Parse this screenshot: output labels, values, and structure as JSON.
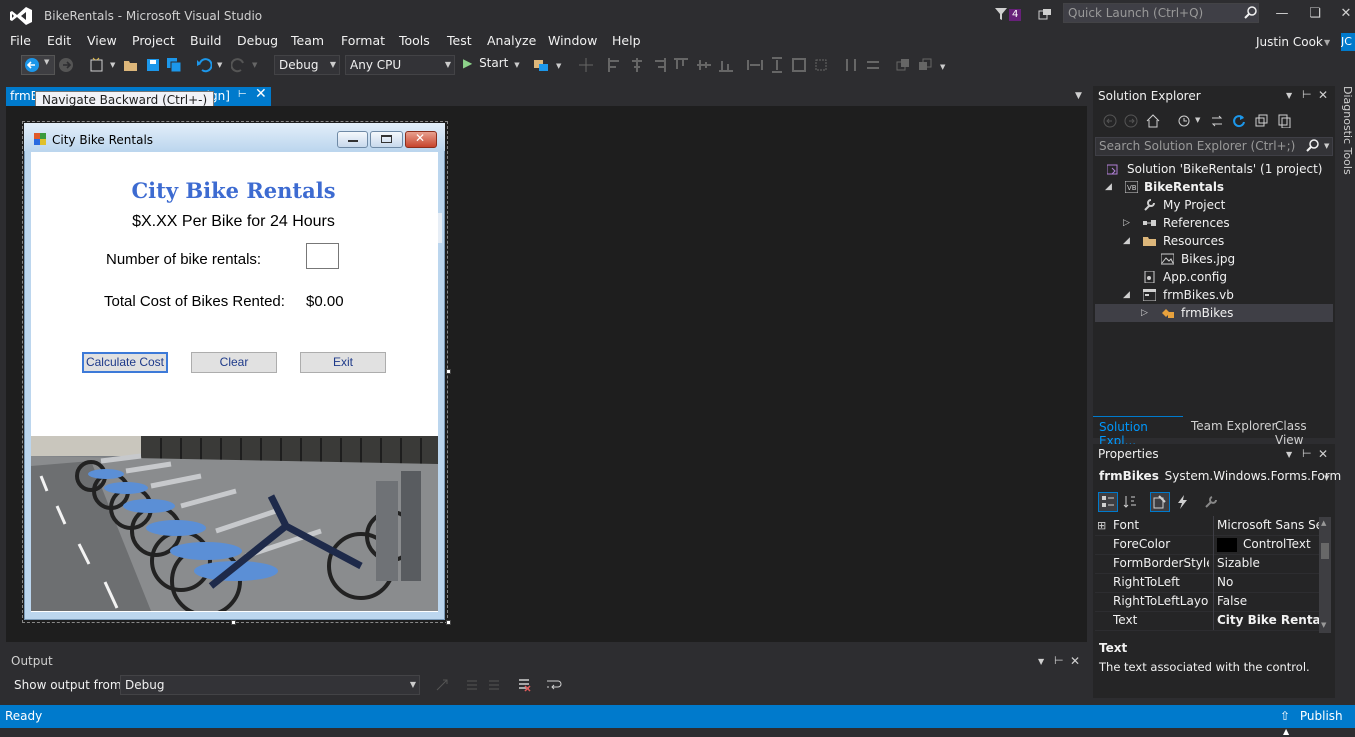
{
  "window": {
    "title": "BikeRentals - Microsoft Visual Studio",
    "notification_count": "4",
    "quick_launch_placeholder": "Quick Launch (Ctrl+Q)",
    "user_name": "Justin Cook",
    "user_initials": "JC"
  },
  "menu": [
    "File",
    "Edit",
    "View",
    "Project",
    "Build",
    "Debug",
    "Team",
    "Format",
    "Tools",
    "Test",
    "Analyze",
    "Window",
    "Help"
  ],
  "toolbar": {
    "config": "Debug",
    "platform": "Any CPU",
    "start_label": "Start"
  },
  "document_tab": {
    "label": "frmBikes.vb [Design]",
    "visible_prefix": "frmB",
    "visible_suffix": "esign]"
  },
  "tooltip": "Navigate Backward (Ctrl+-)",
  "form": {
    "title": "City Bike Rentals",
    "heading": "City Bike Rentals",
    "price_text": "$X.XX Per Bike for 24 Hours",
    "num_label": "Number of bike rentals:",
    "num_value": "",
    "total_label": "Total Cost of Bikes Rented:",
    "total_value": "$0.00",
    "buttons": {
      "calculate": "Calculate Cost",
      "clear": "Clear",
      "exit": "Exit"
    }
  },
  "solution_explorer": {
    "header": "Solution Explorer",
    "search_placeholder": "Search Solution Explorer (Ctrl+;)",
    "items": [
      {
        "label": "Solution 'BikeRentals' (1 project)",
        "icon": "solution-icon",
        "level": 0,
        "expander": "",
        "bold": false
      },
      {
        "label": "BikeRentals",
        "icon": "vb-project-icon",
        "level": 1,
        "expander": "expanded",
        "bold": true
      },
      {
        "label": "My Project",
        "icon": "wrench-icon",
        "level": 2,
        "expander": "",
        "bold": false
      },
      {
        "label": "References",
        "icon": "references-icon",
        "level": 2,
        "expander": "collapsed",
        "bold": false
      },
      {
        "label": "Resources",
        "icon": "folder-icon",
        "level": 2,
        "expander": "expanded",
        "bold": false
      },
      {
        "label": "Bikes.jpg",
        "icon": "image-icon",
        "level": 3,
        "expander": "",
        "bold": false
      },
      {
        "label": "App.config",
        "icon": "config-icon",
        "level": 2,
        "expander": "",
        "bold": false
      },
      {
        "label": "frmBikes.vb",
        "icon": "form-file-icon",
        "level": 2,
        "expander": "expanded",
        "bold": false
      },
      {
        "label": "frmBikes",
        "icon": "class-icon",
        "level": 3,
        "expander": "collapsed",
        "bold": false,
        "selected": true
      }
    ],
    "tabs": [
      "Solution Expl...",
      "Team Explorer",
      "Class View"
    ]
  },
  "diagnostic_tools_label": "Diagnostic Tools",
  "properties": {
    "header": "Properties",
    "object_name": "frmBikes",
    "object_type": "System.Windows.Forms.Form",
    "rows": [
      {
        "name": "Font",
        "value": "Microsoft Sans Serif",
        "expander": true
      },
      {
        "name": "ForeColor",
        "value": "ControlText",
        "swatch": "#000000"
      },
      {
        "name": "FormBorderStyle",
        "value": "Sizable"
      },
      {
        "name": "RightToLeft",
        "value": "No"
      },
      {
        "name": "RightToLeftLayout",
        "value": "False"
      },
      {
        "name": "Text",
        "value": "City Bike Rentals",
        "bold": true
      }
    ],
    "description_title": "Text",
    "description_text": "The text associated with the control."
  },
  "output": {
    "title": "Output",
    "show_from_label": "Show output from:",
    "show_from_value": "Debug"
  },
  "status": {
    "text": "Ready",
    "publish": "Publish"
  },
  "colors": {
    "accent": "#007acc",
    "background": "#2d2d30",
    "designer": "#1e1e1e",
    "heading_blue": "#3d6bd1"
  }
}
